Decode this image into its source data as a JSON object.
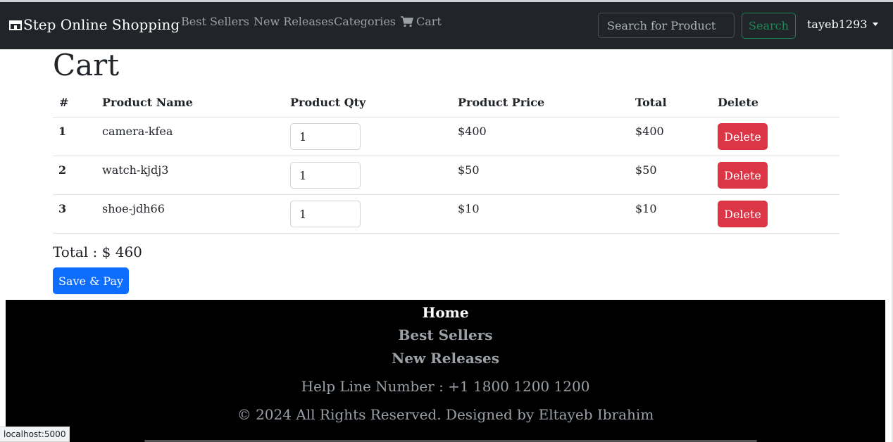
{
  "nav": {
    "brand": "Step Online Shopping",
    "links": [
      "Best Sellers",
      "New Releases",
      "Categories"
    ],
    "cart": "Cart",
    "search_placeholder": "Search for Product",
    "search_button": "Search",
    "user": "tayeb1293"
  },
  "page": {
    "title": "Cart"
  },
  "table": {
    "headers": [
      "#",
      "Product Name",
      "Product Qty",
      "Product Price",
      "Total",
      "Delete"
    ],
    "rows": [
      {
        "index": "1",
        "name": "camera-kfea",
        "qty": "1",
        "price": "$400",
        "total": "$400",
        "delete": "Delete"
      },
      {
        "index": "2",
        "name": "watch-kjdj3",
        "qty": "1",
        "price": "$50",
        "total": "$50",
        "delete": "Delete"
      },
      {
        "index": "3",
        "name": "shoe-jdh66",
        "qty": "1",
        "price": "$10",
        "total": "$10",
        "delete": "Delete"
      }
    ]
  },
  "summary": {
    "total_label": "Total : $ 460",
    "pay_button": "Save & Pay"
  },
  "footer": {
    "links": [
      "Home",
      "Best Sellers",
      "New Releases"
    ],
    "help": "Help Line Number : +1 1800 1200 1200",
    "copyright": "© 2024 All Rights Reserved. Designed by Eltayeb Ibrahim"
  },
  "status_bar": {
    "url": "localhost:5000"
  },
  "colors": {
    "navbar": "#212529",
    "danger": "#dc3545",
    "primary": "#0d6efd",
    "success": "#198754",
    "footer": "#000000"
  },
  "icons": [
    "shop-icon",
    "cart-icon",
    "chevron-down-icon"
  ]
}
